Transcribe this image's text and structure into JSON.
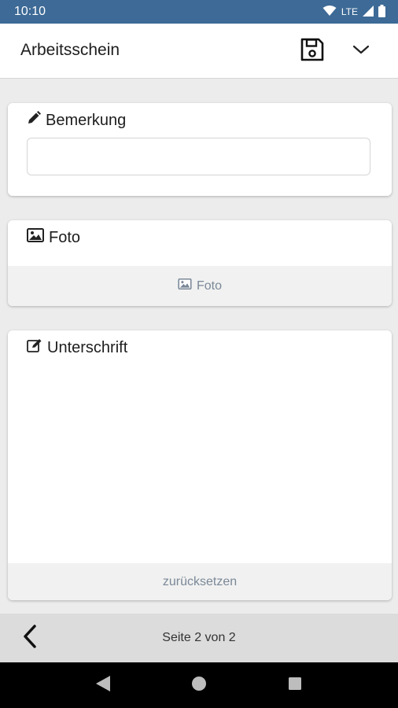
{
  "status_bar": {
    "time": "10:10",
    "network": "LTE",
    "icons": [
      "wifi-icon",
      "signal-icon",
      "battery-icon"
    ]
  },
  "app_bar": {
    "title": "Arbeitsschein",
    "icons": [
      "save-icon",
      "chevron-down-icon"
    ]
  },
  "cards": {
    "note": {
      "title": "Bemerkung",
      "icon": "pencil-icon",
      "input_value": ""
    },
    "photo": {
      "title": "Foto",
      "icon": "image-icon",
      "button_label": "Foto"
    },
    "signature": {
      "title": "Unterschrift",
      "icon": "edit-icon",
      "reset_label": "zurücksetzen"
    }
  },
  "pager": {
    "label": "Seite 2 von 2",
    "icon": "chevron-left-icon"
  },
  "nav_bar": {
    "icons": [
      "back-triangle-icon",
      "home-circle-icon",
      "recents-square-icon"
    ]
  },
  "colors": {
    "status_bar": "#3d6a96",
    "page_background": "#ececec",
    "muted_text": "#7a8897"
  }
}
